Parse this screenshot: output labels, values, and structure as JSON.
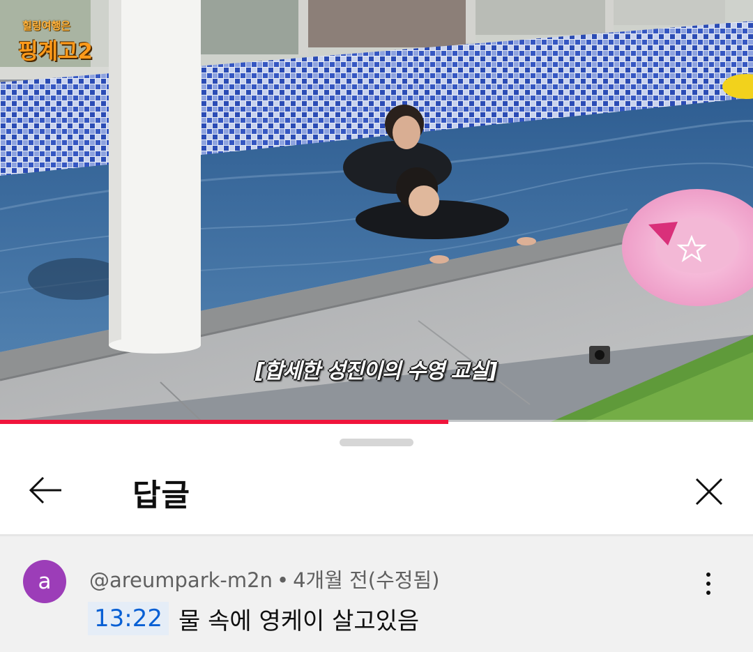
{
  "video": {
    "channel_logo_sub": "힐링여행은",
    "channel_logo_main": "핑계고2",
    "subtitle": "[합세한 성진이의 수영 교실]",
    "progress_fraction": 0.595,
    "colors": {
      "progress": "#f0143c",
      "pool_water": "#3d6e9a",
      "pool_tile": "#2c4fb8",
      "float_ring": "#f2a6cf"
    }
  },
  "sheet": {
    "title": "답글",
    "back_icon": "arrow-left-icon",
    "close_icon": "close-icon"
  },
  "comment": {
    "avatar_letter": "a",
    "avatar_color": "#9c3db8",
    "author": "@areumpark-m2n",
    "separator": "•",
    "time": "4개월 전(수정됨)",
    "timestamp_link": "13:22",
    "text": "물 속에 영케이 살고있음",
    "more_icon": "more-vertical-icon"
  }
}
